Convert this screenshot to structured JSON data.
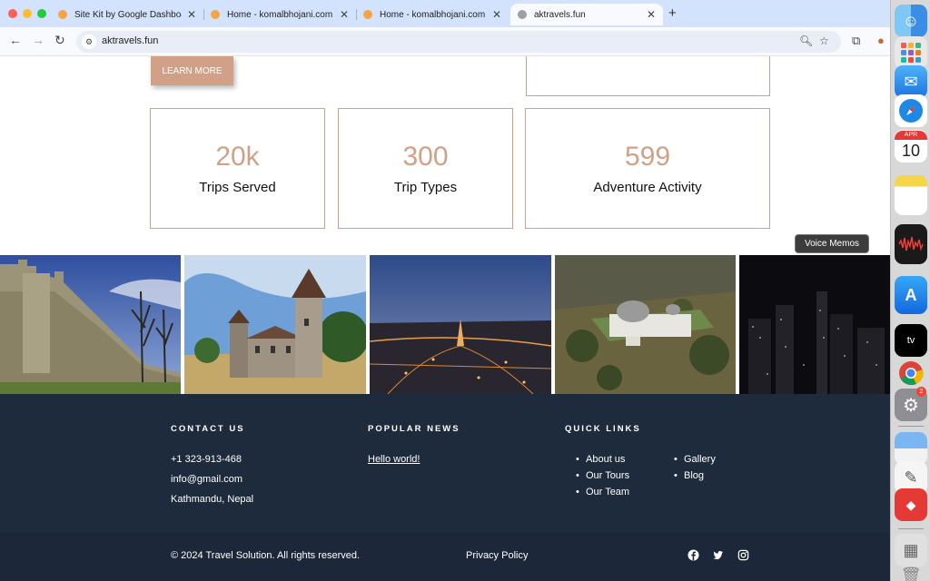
{
  "browser": {
    "tabs": [
      {
        "title": "Site Kit by Google Dashboard",
        "active": false
      },
      {
        "title": "Home - komalbhojani.com",
        "active": false
      },
      {
        "title": "Home - komalbhojani.com",
        "active": false
      },
      {
        "title": "aktravels.fun",
        "active": true
      }
    ],
    "new_tab": "+",
    "url": "aktravels.fun"
  },
  "page": {
    "learn_more": "LEARN MORE",
    "stats": [
      {
        "value": "20k",
        "label": "Trips Served"
      },
      {
        "value": "300",
        "label": "Trip Types"
      },
      {
        "value": "599",
        "label": "Adventure Activity"
      }
    ],
    "gallery_images": [
      "castle-wall",
      "chateau",
      "paris-night",
      "observatory",
      "city-night"
    ]
  },
  "footer": {
    "contact": {
      "heading": "CONTACT US",
      "phone": "+1 323-913-468",
      "email": "info@gmail.com",
      "address": "Kathmandu, Nepal"
    },
    "news": {
      "heading": "POPULAR NEWS",
      "item": "Hello world!"
    },
    "links": {
      "heading": "QUICK LINKS",
      "col1": [
        "About us",
        "Our Tours",
        "Our Team"
      ],
      "col2": [
        "Gallery",
        "Blog"
      ]
    },
    "copyright": "© 2024 Travel Solution. All rights reserved.",
    "privacy": "Privacy Policy",
    "social": [
      "facebook",
      "twitter",
      "instagram"
    ]
  },
  "dock": {
    "tooltip": "Voice Memos",
    "calendar_month": "APR",
    "calendar_day": "10",
    "tv_label": "tv",
    "settings_badge": "2"
  },
  "colors": {
    "accent": "#d1a087",
    "footer_bg": "#1e2b3d",
    "tabstrip": "#d3e3fd"
  }
}
